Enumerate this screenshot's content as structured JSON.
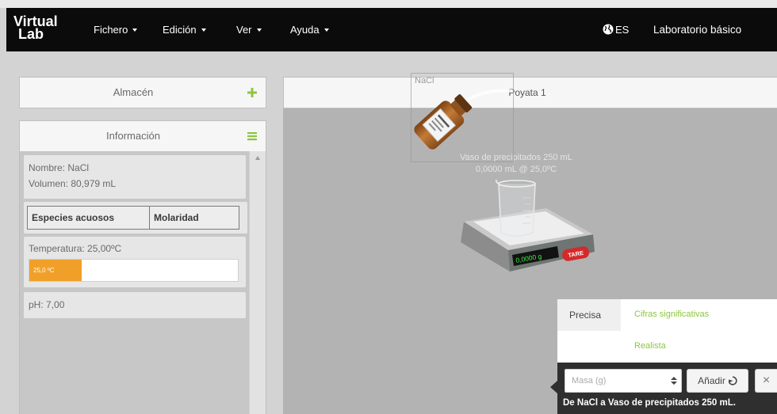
{
  "navbar": {
    "logo": {
      "line1": "Virtual",
      "line2": "Lab"
    },
    "menus": [
      {
        "label": "Fichero",
        "icon": "caret-down-icon"
      },
      {
        "label": "Edición",
        "icon": "caret-down-icon"
      },
      {
        "label": "Ver",
        "icon": "caret-down-icon"
      },
      {
        "label": "Ayuda",
        "icon": "caret-down-icon"
      }
    ],
    "language": {
      "icon": "globe-icon",
      "label": "ES"
    },
    "lab_name": "Laboratorio básico"
  },
  "sidebar": {
    "store": {
      "title": "Almacén",
      "icon": "plus-icon"
    },
    "info": {
      "title": "Información",
      "icon": "menu-lines-icon",
      "name_line": "Nombre: NaCl",
      "volume_line": "Volumen: 80,979 mL",
      "species_table": {
        "headers": [
          "Especies acuosos",
          "Molaridad"
        ]
      },
      "temperature_line": "Temperatura: 25,00ºC",
      "temperature_bar": {
        "label": "25,0 ºC",
        "level": 0.25
      },
      "ph_line": "pH: 7,00"
    }
  },
  "workbench": {
    "title": "Poyata 1",
    "selected_item": "NaCl",
    "beaker": {
      "name": "Vaso de precipitados 250 mL",
      "contents": "0,0000 mL @ 25,0ºC"
    },
    "balance": {
      "reading": "0,0000 g",
      "tare_label": "TARE"
    }
  },
  "transfer_popup": {
    "modes": [
      {
        "label": "Precisa",
        "active": true
      },
      {
        "label": "Cifras significativas",
        "active": false
      },
      {
        "label": "Realista",
        "active": false
      }
    ],
    "mass_input": {
      "placeholder": "Masa (g)",
      "value": ""
    },
    "add_button": {
      "label": "Añadir",
      "icon": "enter-icon"
    },
    "close_button": {
      "label": "×"
    },
    "description": "De NaCl a Vaso de precipitados 250 mL."
  },
  "colors": {
    "navbar_background": "#0b0b0b",
    "accent_green": "#8dc63f",
    "temperature_bar_fill": "#f0a028",
    "balance_display_text": "#3df03d",
    "tare_button": "#d42a2a",
    "bottle_brown": "#c47a36"
  }
}
